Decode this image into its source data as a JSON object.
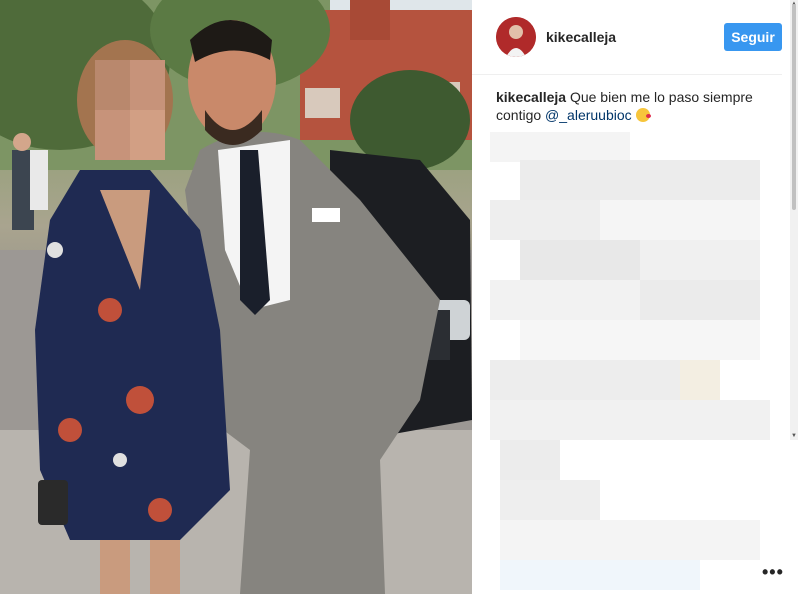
{
  "post": {
    "username": "kikecalleja",
    "follow_label": "Seguir",
    "caption_author": "kikecalleja",
    "caption_text": " Que bien me lo paso siempre contigo ",
    "caption_mention": "@_aleruubioc",
    "emoji_icon": "kissing-face-emoji"
  },
  "colors": {
    "follow_button": "#3897f0",
    "mention": "#003569"
  },
  "menu": {
    "more_label": "•••"
  }
}
